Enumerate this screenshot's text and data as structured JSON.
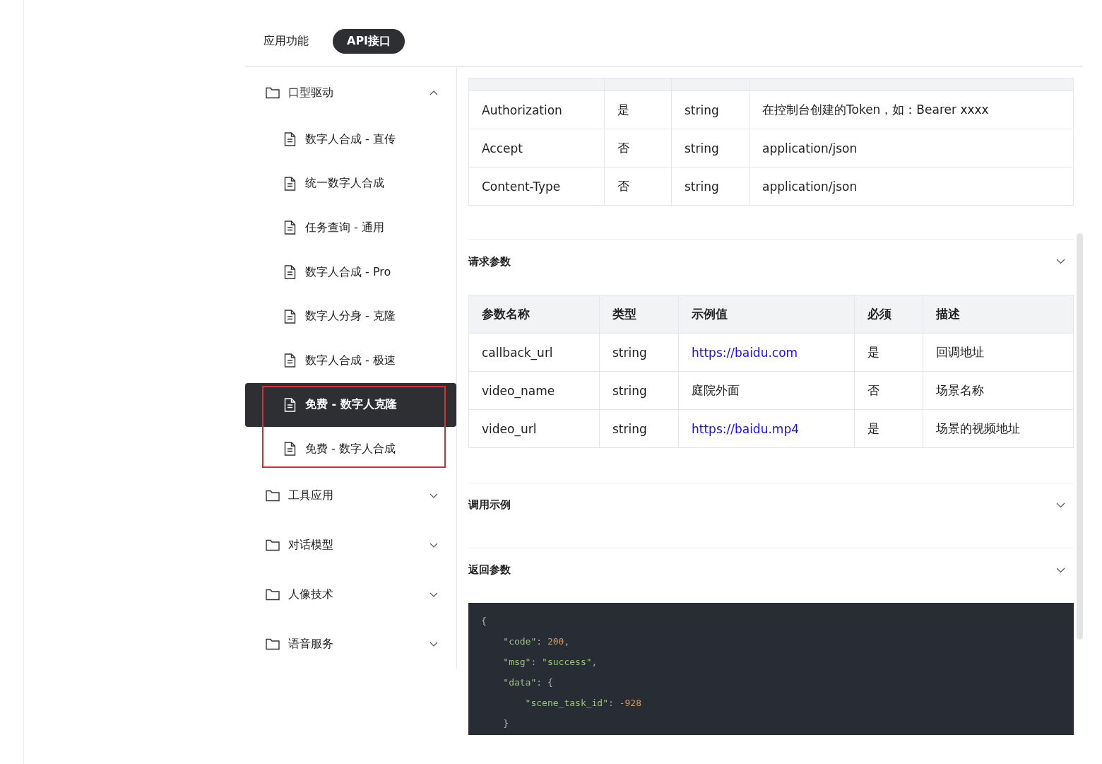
{
  "tabs": [
    {
      "label": "应用功能",
      "selected": false
    },
    {
      "label": "API接口",
      "selected": true
    }
  ],
  "sidebar": {
    "groups": [
      {
        "label": "口型驱动",
        "expanded": true,
        "children": [
          {
            "label": "数字人合成 - 直传",
            "selected": false
          },
          {
            "label": "统一数字人合成",
            "selected": false
          },
          {
            "label": "任务查询 - 通用",
            "selected": false
          },
          {
            "label": "数字人合成 - Pro",
            "selected": false
          },
          {
            "label": "数字人分身 - 克隆",
            "selected": false
          },
          {
            "label": "数字人合成 - 极速",
            "selected": false
          },
          {
            "label": "免费 - 数字人克隆",
            "selected": true
          },
          {
            "label": "免费 - 数字人合成",
            "selected": false
          }
        ]
      },
      {
        "label": "工具应用",
        "expanded": false
      },
      {
        "label": "对话模型",
        "expanded": false
      },
      {
        "label": "人像技术",
        "expanded": false
      },
      {
        "label": "语音服务",
        "expanded": false
      }
    ]
  },
  "header_table": {
    "rows": [
      [
        "Authorization",
        "是",
        "string",
        "在控制台创建的Token，如：Bearer xxxx"
      ],
      [
        "Accept",
        "否",
        "string",
        "application/json"
      ],
      [
        "Content-Type",
        "否",
        "string",
        "application/json"
      ]
    ]
  },
  "sections": [
    {
      "kind": "table",
      "title": "请求参数",
      "columns": [
        "参数名称",
        "类型",
        "示例值",
        "必须",
        "描述"
      ],
      "rows": [
        [
          {
            "text": "callback_url",
            "link": false
          },
          {
            "text": "string",
            "link": false
          },
          {
            "text": "https://baidu.com",
            "link": true
          },
          {
            "text": "是",
            "link": false
          },
          {
            "text": "回调地址",
            "link": false
          }
        ],
        [
          {
            "text": "video_name",
            "link": false
          },
          {
            "text": "string",
            "link": false
          },
          {
            "text": "庭院外面",
            "link": false
          },
          {
            "text": "否",
            "link": false
          },
          {
            "text": "场景名称",
            "link": false
          }
        ],
        [
          {
            "text": "video_url",
            "link": false
          },
          {
            "text": "string",
            "link": false
          },
          {
            "text": "https://baidu.mp4",
            "link": true
          },
          {
            "text": "是",
            "link": false
          },
          {
            "text": "场景的视频地址",
            "link": false
          }
        ]
      ]
    },
    {
      "kind": "plain",
      "title": "调用示例"
    },
    {
      "kind": "code",
      "title": "返回参数",
      "lines": [
        [
          {
            "kind": "punct",
            "text": "{"
          }
        ],
        [
          {
            "kind": "key",
            "text": "    \"code\""
          },
          {
            "kind": "punct",
            "text": ": "
          },
          {
            "kind": "number",
            "text": "200"
          },
          {
            "kind": "punct",
            "text": ","
          }
        ],
        [
          {
            "kind": "key",
            "text": "    \"msg\""
          },
          {
            "kind": "punct",
            "text": ": "
          },
          {
            "kind": "key",
            "text": "\"success\""
          },
          {
            "kind": "punct",
            "text": ","
          }
        ],
        [
          {
            "kind": "key",
            "text": "    \"data\""
          },
          {
            "kind": "punct",
            "text": ": {"
          }
        ],
        [
          {
            "kind": "key",
            "text": "        \"scene_task_id\""
          },
          {
            "kind": "punct",
            "text": ": "
          },
          {
            "kind": "number",
            "text": "-928"
          }
        ],
        [
          {
            "kind": "punct",
            "text": "    }"
          }
        ]
      ]
    }
  ]
}
